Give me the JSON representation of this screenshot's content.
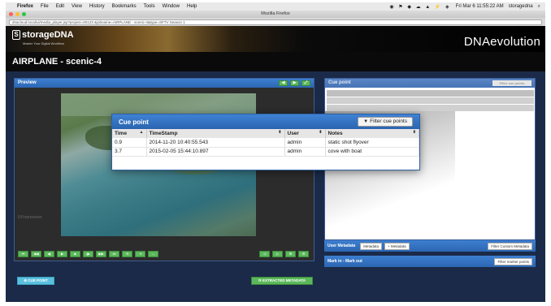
{
  "menubar": {
    "app": "Firefox",
    "items": [
      "File",
      "Edit",
      "View",
      "History",
      "Bookmarks",
      "Tools",
      "Window",
      "Help"
    ],
    "clock": "Fri Mar 6 11:55:22 AM",
    "user": "storagedna"
  },
  "browser": {
    "window_title": "Mozilla Firefox",
    "url": "dnacloud.local/ui/media_player.jsp?project=00123 &jobname=AIRPLANE - scenic-4&type=SFTV Season 1"
  },
  "app": {
    "logo_name": "storageDNA",
    "logo_tagline": "Master Your Digital Workflow",
    "brand": "DNAevolution",
    "page_title": "AIRPLANE - scenic-4"
  },
  "preview": {
    "title": "Preview",
    "timecode": "0:Freezeover",
    "cue_point_button": "⊕ CUE POINT",
    "extracted_metadata_button": "⟳ EXTRACTED METADATA",
    "transport": [
      "⏮",
      "◀◀",
      "◀|",
      "▶",
      "■",
      "|▶",
      "▶▶",
      "⏭",
      "⟲",
      "⇥",
      "↔"
    ],
    "transport_right": [
      "◁",
      "▷",
      "⊞",
      "⚙"
    ]
  },
  "right_panel": {
    "title": "Cue point",
    "filter_label": "Filter cue points"
  },
  "user_metadata": {
    "label": "User Metadata",
    "select": "Metadata",
    "add": "+ Metadata",
    "filter": "Filter Custom Metadata"
  },
  "mark_in_out": {
    "label": "Mark in - Mark out",
    "filter": "Filter marker points"
  },
  "popup": {
    "title": "Cue point",
    "filter_button": "Filter cue points",
    "columns": [
      "Time",
      "TimeStamp",
      "User",
      "Notes"
    ],
    "rows": [
      {
        "time": "0.9",
        "timestamp": "2014-11-20 10:40:55.543",
        "user": "admin",
        "notes": "static shot flyover"
      },
      {
        "time": "3.7",
        "timestamp": "2015-02-05 15:44:10.897",
        "user": "admin",
        "notes": "cove with boat"
      }
    ]
  },
  "colors": {
    "panel_header": "#2c66b3",
    "green_button": "#5cb85c",
    "cyan_button": "#5bc0de",
    "app_background": "#1b2a48"
  }
}
